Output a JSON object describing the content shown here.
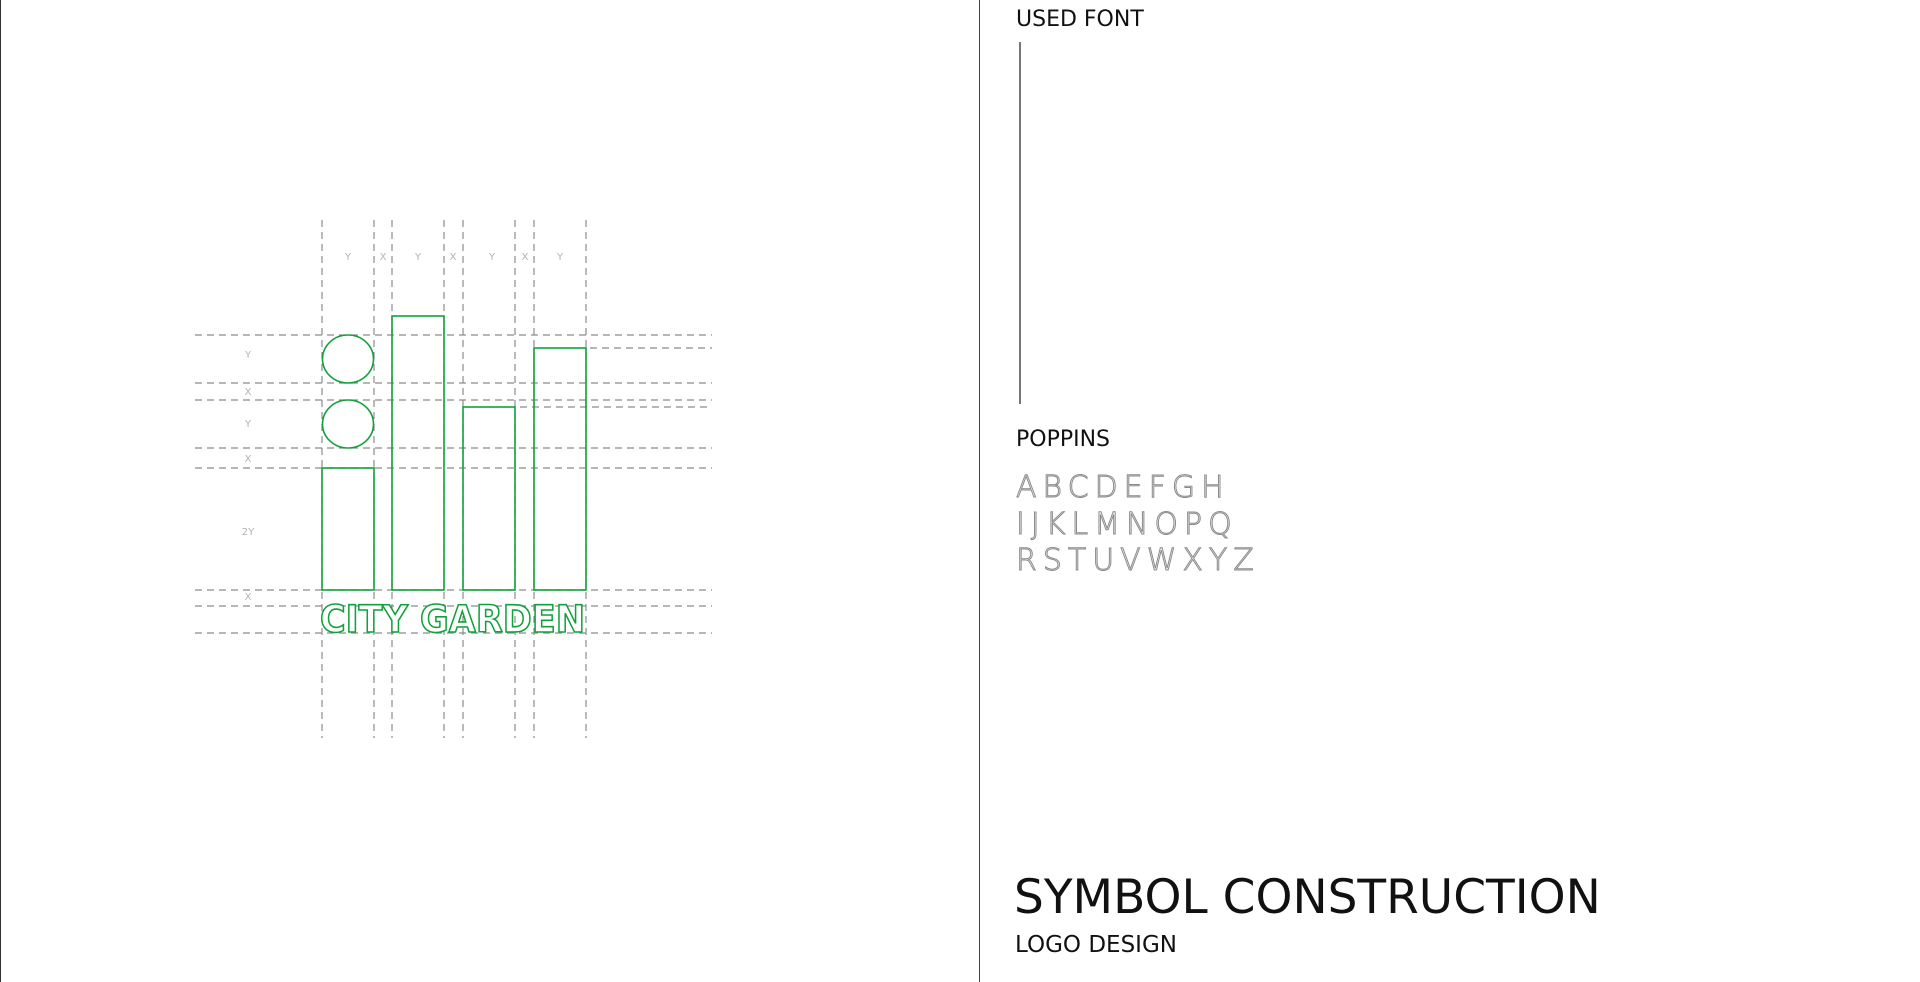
{
  "logo": {
    "wordmark": "CITY GARDEN",
    "color": "#11a13a"
  },
  "construction": {
    "column_labels": [
      "Y",
      "X",
      "Y",
      "X",
      "Y",
      "X",
      "Y"
    ],
    "row_labels": [
      "Y",
      "X",
      "Y",
      "X",
      "2Y",
      "X"
    ],
    "guide_color": "#8c8c8c"
  },
  "font_panel": {
    "heading": "USED FONT",
    "font_name": "POPPINS",
    "alphabet_lines": [
      "ABCDEFGH",
      "IJKLMNOPQ",
      "RSTUVWXYZ"
    ]
  },
  "footer": {
    "title": "SYMBOL CONSTRUCTION",
    "subtitle": "LOGO DESIGN"
  }
}
